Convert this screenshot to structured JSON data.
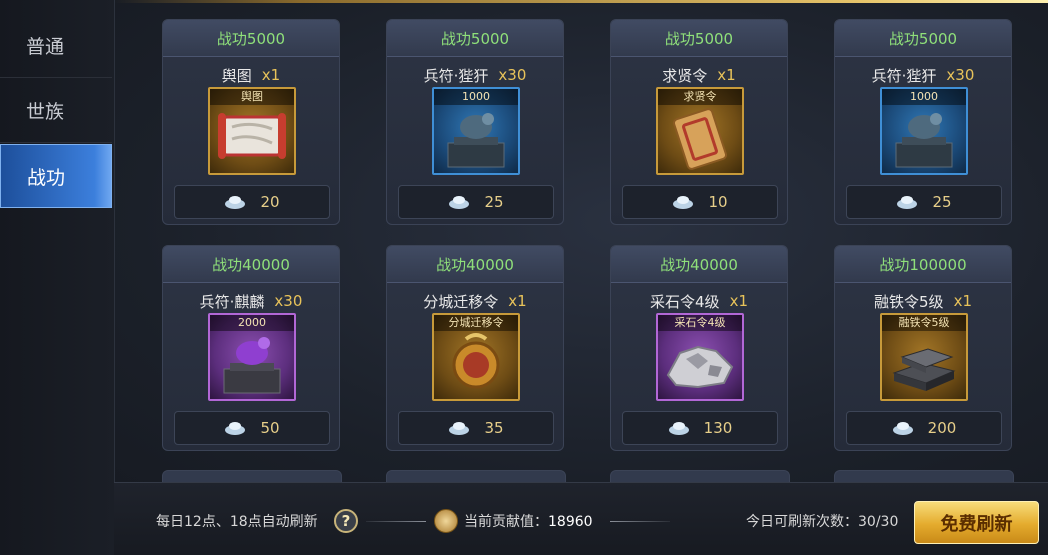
{
  "sidebar": {
    "tabs": [
      {
        "label": "普通"
      },
      {
        "label": "世族"
      },
      {
        "label": "战功"
      }
    ],
    "active_index": 2
  },
  "cards": [
    {
      "header": "战功5000",
      "name": "舆图",
      "qty": "x1",
      "item_label": "舆图",
      "item_type": "map-scroll-icon",
      "price": "20"
    },
    {
      "header": "战功5000",
      "name": "兵符·狴犴",
      "qty": "x30",
      "item_label": "1000",
      "item_type": "bronze-seal-icon",
      "price": "25"
    },
    {
      "header": "战功5000",
      "name": "求贤令",
      "qty": "x1",
      "item_label": "求贤令",
      "item_type": "golden-tablet-icon",
      "price": "10"
    },
    {
      "header": "战功5000",
      "name": "兵符·狴犴",
      "qty": "x30",
      "item_label": "1000",
      "item_type": "bronze-seal-icon",
      "price": "25"
    },
    {
      "header": "战功40000",
      "name": "兵符·麒麟",
      "qty": "x30",
      "item_label": "2000",
      "item_type": "purple-seal-icon",
      "price": "50"
    },
    {
      "header": "战功40000",
      "name": "分城迁移令",
      "qty": "x1",
      "item_label": "分城迁移令",
      "item_type": "relocation-token-icon",
      "price": "35"
    },
    {
      "header": "战功40000",
      "name": "采石令4级",
      "qty": "x1",
      "item_label": "采石令4级",
      "item_type": "stone-ore-icon",
      "price": "130"
    },
    {
      "header": "战功100000",
      "name": "融铁令5级",
      "qty": "x1",
      "item_label": "融铁令5级",
      "item_type": "iron-ingot-icon",
      "price": "200"
    }
  ],
  "currency_icon": "silver-ingot-icon",
  "bottom": {
    "note": "每日12点、18点自动刷新",
    "help": "?",
    "contrib_label": "当前贡献值：",
    "contrib_value": "18960",
    "refresh_count": "今日可刷新次数：30/30",
    "refresh_button": "免费刷新"
  },
  "colors": {
    "header_text": "#8fe07a",
    "qty_text": "#e8c35a",
    "active_tab": "#3c7fdc",
    "button_gold": "#e4ab2d"
  }
}
